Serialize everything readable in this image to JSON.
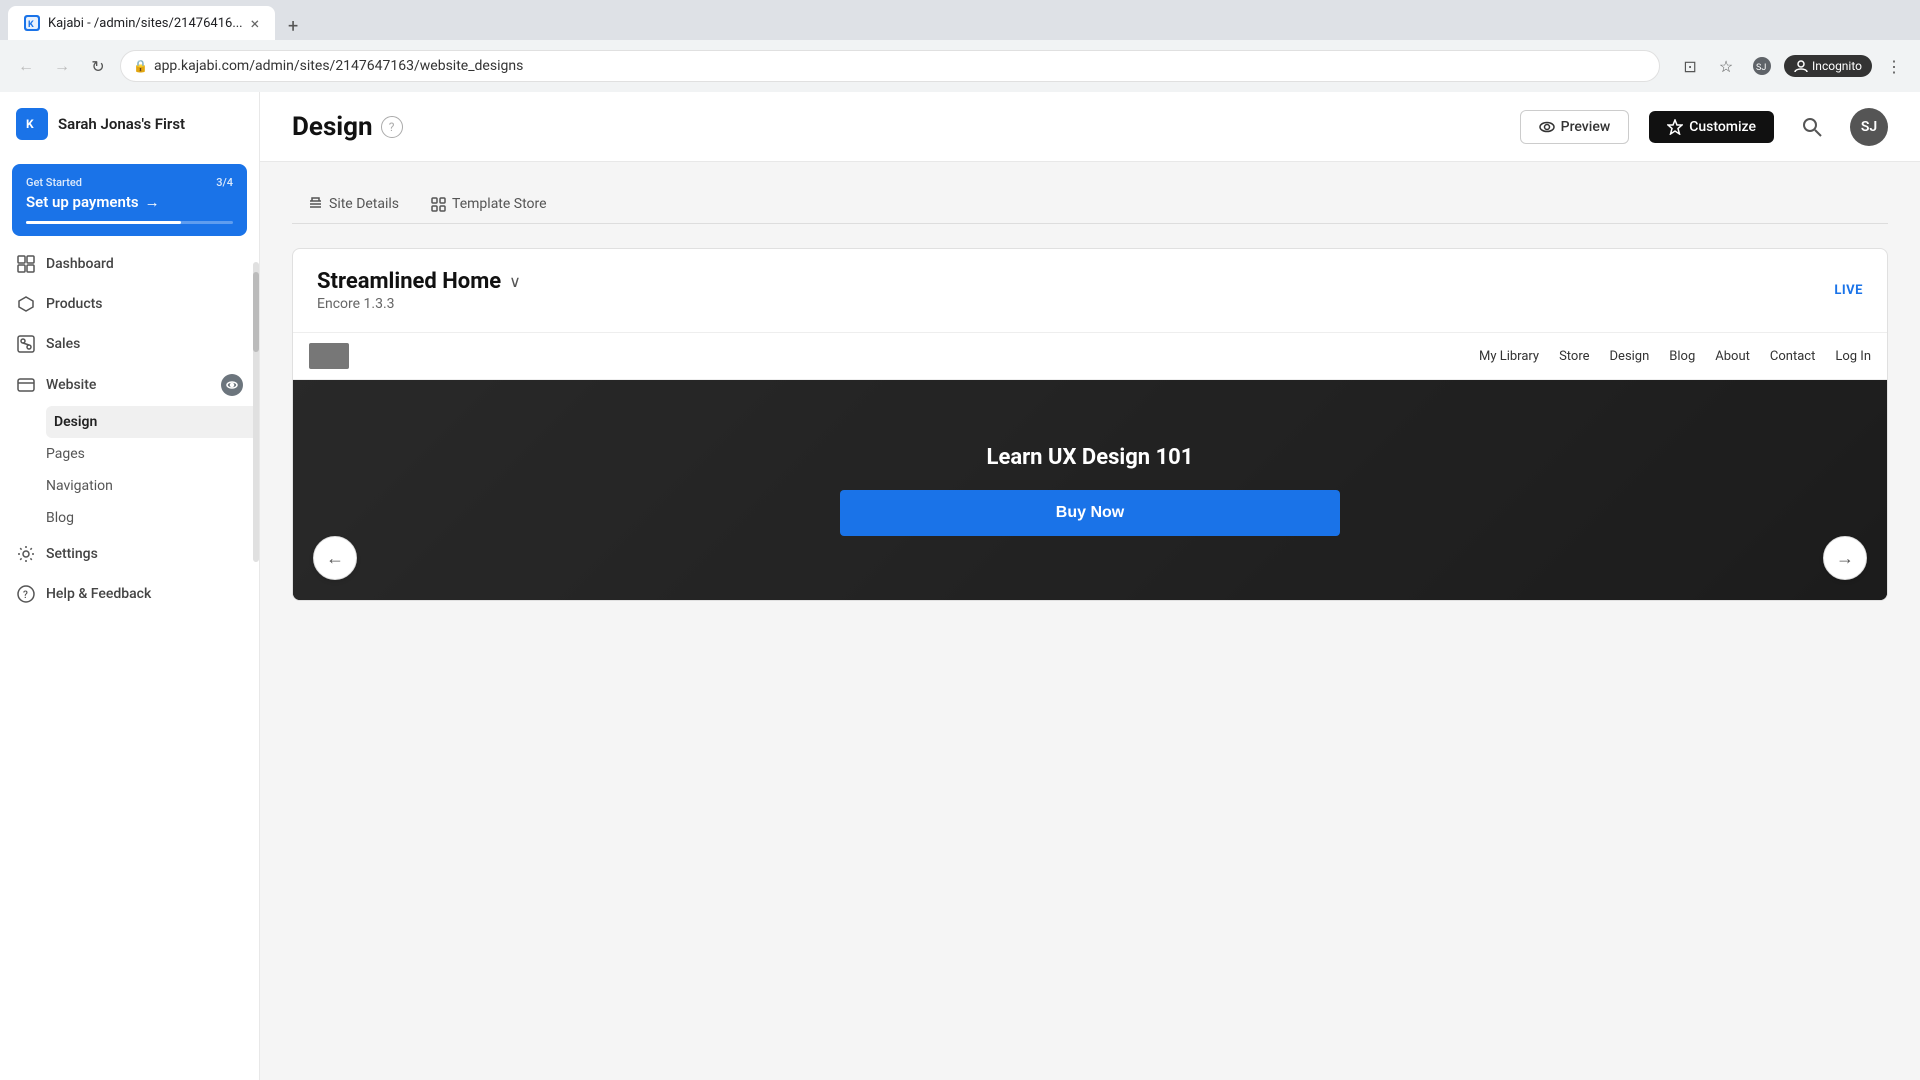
{
  "browser": {
    "tab_favicon": "K",
    "tab_title": "Kajabi - /admin/sites/21476416...",
    "tab_close": "×",
    "new_tab": "+",
    "address": "app.kajabi.com/admin/sites/2147647163/website_designs",
    "incognito_label": "Incognito"
  },
  "header": {
    "search_icon": "🔍",
    "avatar_label": "SJ"
  },
  "sidebar": {
    "logo_letter": "K",
    "brand": "Sarah Jonas's First",
    "get_started": {
      "label": "Get Started",
      "progress_text": "3/4",
      "title": "Set up payments",
      "arrow": "→"
    },
    "nav_items": [
      {
        "id": "dashboard",
        "icon": "⌂",
        "label": "Dashboard"
      },
      {
        "id": "products",
        "icon": "◇",
        "label": "Products"
      },
      {
        "id": "sales",
        "icon": "◆",
        "label": "Sales"
      },
      {
        "id": "website",
        "icon": "▭",
        "label": "Website",
        "has_eye": true
      },
      {
        "id": "settings",
        "icon": "⚙",
        "label": "Settings"
      },
      {
        "id": "help",
        "icon": "?",
        "label": "Help & Feedback"
      }
    ],
    "website_sub_items": [
      {
        "id": "design",
        "label": "Design",
        "active": true
      },
      {
        "id": "pages",
        "label": "Pages"
      },
      {
        "id": "navigation",
        "label": "Navigation"
      },
      {
        "id": "blog",
        "label": "Blog"
      }
    ]
  },
  "main": {
    "page_title": "Design",
    "help_icon": "?",
    "tabs": [
      {
        "id": "site-details",
        "icon": "✏",
        "label": "Site Details"
      },
      {
        "id": "template-store",
        "icon": "⊞",
        "label": "Template Store"
      }
    ],
    "design_card": {
      "title": "Streamlined Home",
      "chevron": "∨",
      "subtitle": "Encore 1.3.3",
      "live_label": "LIVE"
    },
    "preview": {
      "nav_links": [
        "My Library",
        "Store",
        "Design",
        "Blog",
        "About",
        "Contact",
        "Log In"
      ],
      "hero_title": "Learn UX Design 101",
      "buy_btn_label": "Buy Now",
      "arrow_left": "←",
      "arrow_right": "→"
    },
    "buttons": {
      "preview_icon": "👁",
      "preview_label": "Preview",
      "customize_icon": "✦",
      "customize_label": "Customize"
    }
  },
  "colors": {
    "accent": "#1a73e8",
    "dark": "#111111",
    "live": "#1a73e8",
    "buy_btn": "#1a73e8"
  }
}
